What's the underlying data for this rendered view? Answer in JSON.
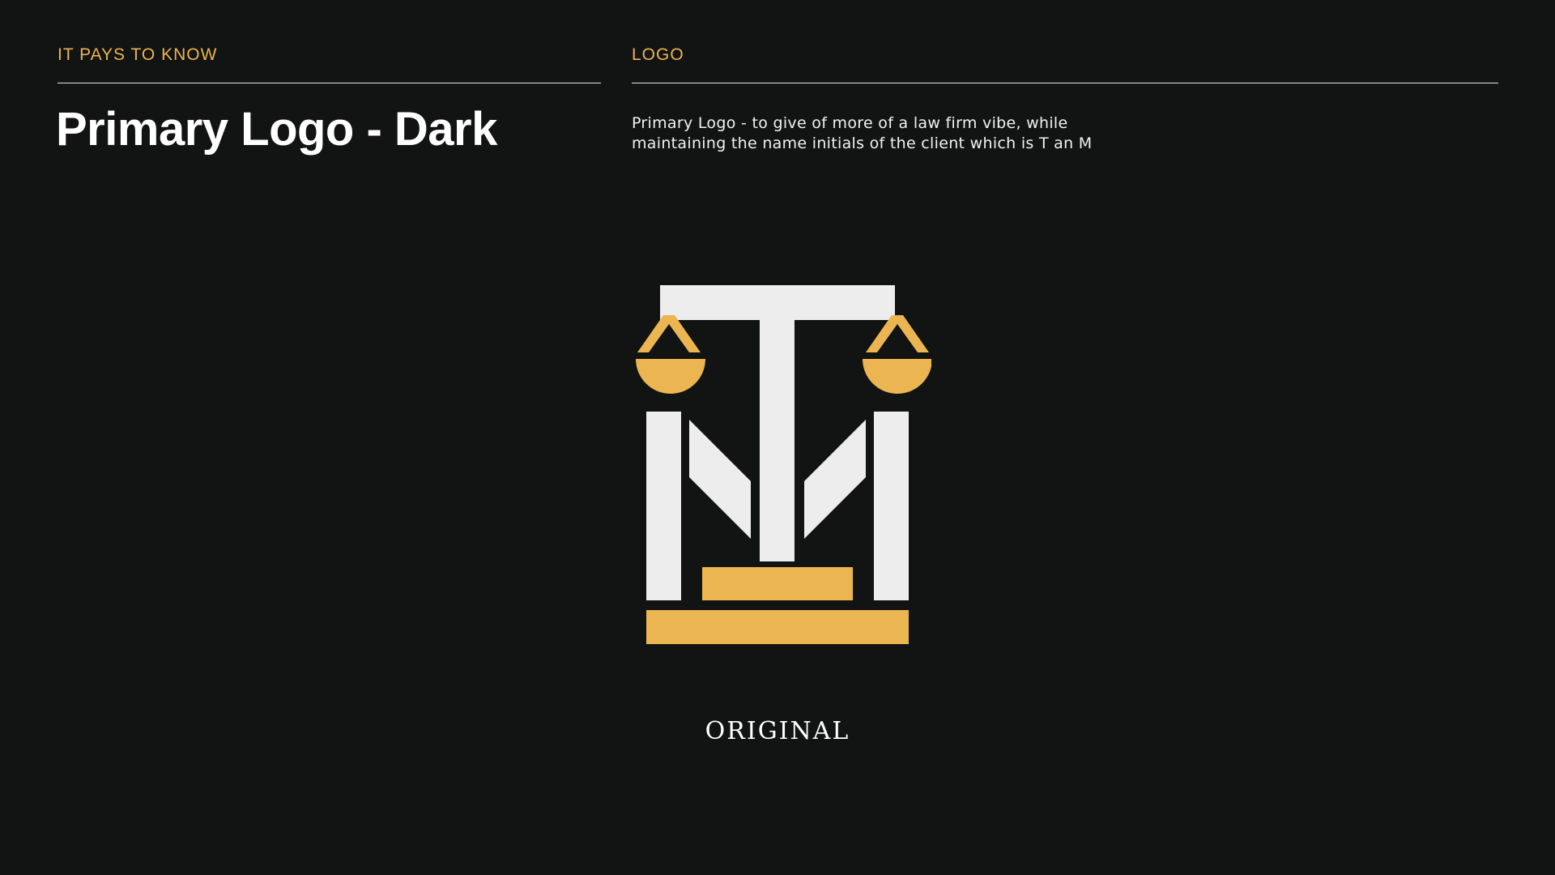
{
  "header": {
    "left_eyebrow": "IT PAYS TO KNOW",
    "right_eyebrow": "LOGO",
    "title": "Primary Logo - Dark",
    "description": "Primary Logo - to give of more of a law firm vibe, while maintaining the name initials of the client which is T an M"
  },
  "logo": {
    "icon": "scales-of-justice-tm-monogram",
    "colors": {
      "background": "#121313",
      "primary": "#EDEDED",
      "accent": "#EBB551"
    }
  },
  "caption": "ORIGINAL"
}
